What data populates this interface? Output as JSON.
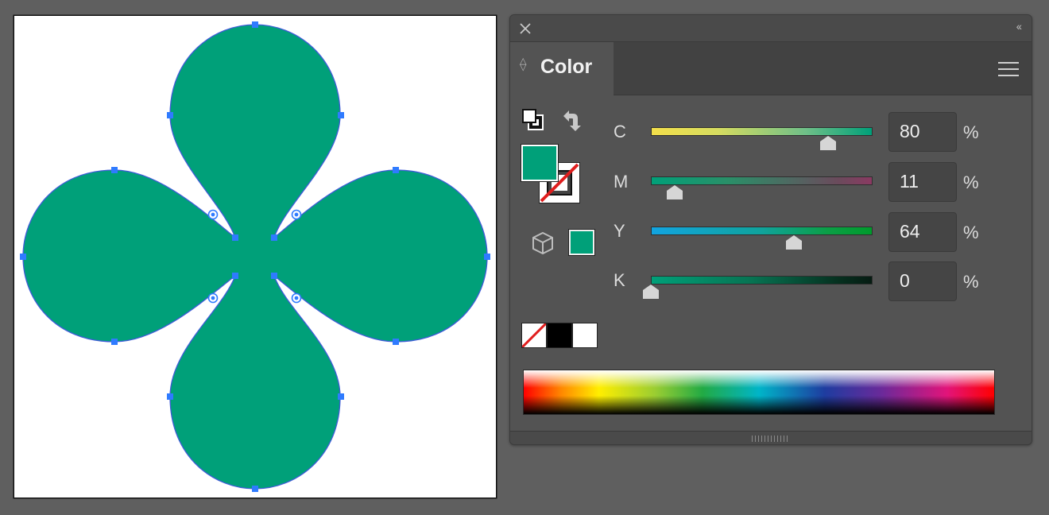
{
  "panel": {
    "title": "Color",
    "channels": [
      {
        "label": "C",
        "value": "80",
        "unit": "%"
      },
      {
        "label": "M",
        "value": "11",
        "unit": "%"
      },
      {
        "label": "Y",
        "value": "64",
        "unit": "%"
      },
      {
        "label": "K",
        "value": "0",
        "unit": "%"
      }
    ]
  },
  "colors": {
    "fill": "#00a079",
    "shape_outline": "#3f5bd8",
    "anchor": "#2f7bff",
    "panel_bg": "#535353"
  },
  "icons": [
    "close-icon",
    "collapse-icon",
    "panel-menu-icon",
    "default-fill-stroke-icon",
    "swap-fill-stroke-icon",
    "out-of-gamut-cube-icon",
    "none-swatch-icon"
  ]
}
